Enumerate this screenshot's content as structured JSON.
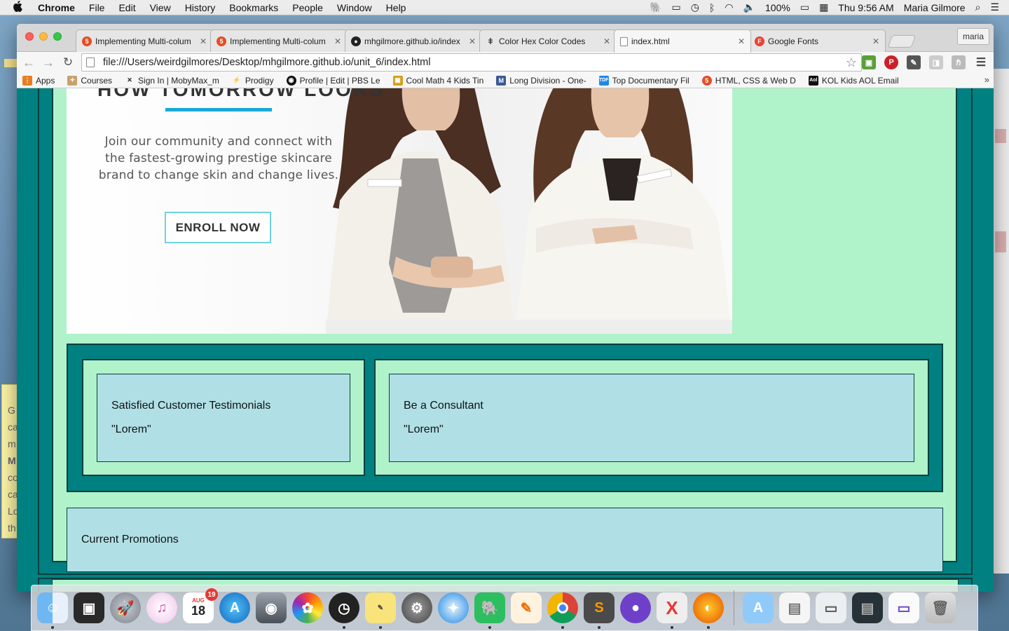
{
  "menubar": {
    "app_name": "Chrome",
    "items": [
      "File",
      "Edit",
      "View",
      "History",
      "Bookmarks",
      "People",
      "Window",
      "Help"
    ],
    "battery": "100%",
    "clock": "Thu 9:56 AM",
    "user": "Maria Gilmore"
  },
  "browser": {
    "tabs": [
      {
        "label": "Implementing Multi-colum",
        "icon": "html-shield-icon",
        "color": "#e44d26"
      },
      {
        "label": "Implementing Multi-colum",
        "icon": "html-shield-icon",
        "color": "#e44d26"
      },
      {
        "label": "mhgilmore.github.io/index",
        "icon": "github-icon",
        "color": "#222222"
      },
      {
        "label": "Color Hex Color Codes",
        "icon": "eyedropper-icon",
        "color": "#333333"
      },
      {
        "label": "index.html",
        "icon": "page-icon",
        "color": "#888888"
      },
      {
        "label": "Google Fonts",
        "icon": "google-fonts-icon",
        "color": "#ea4335"
      }
    ],
    "active_tab": 4,
    "profile": "maria",
    "url": "file:///Users/weirdgilmores/Desktop/mhgilmore.github.io/unit_6/index.html",
    "bookmarks": [
      {
        "label": "Apps",
        "icon": "apps-grid-icon",
        "color": "#e67e22"
      },
      {
        "label": "Courses",
        "icon": "courses-icon",
        "color": "#c9a26b"
      },
      {
        "label": "Sign In | MobyMax_m",
        "icon": "mobymax-icon",
        "color": "#222222"
      },
      {
        "label": "Prodigy",
        "icon": "prodigy-icon",
        "color": "#3f51b5"
      },
      {
        "label": "Profile | Edit | PBS Le",
        "icon": "pbs-icon",
        "color": "#111111"
      },
      {
        "label": "Cool Math 4 Kids Tin",
        "icon": "coolmath-icon",
        "color": "#d4a017"
      },
      {
        "label": "Long Division - One-",
        "icon": "m-icon",
        "color": "#3b5998"
      },
      {
        "label": "Top Documentary Fil",
        "icon": "tdf-icon",
        "color": "#1e88e5"
      },
      {
        "label": "HTML, CSS & Web D",
        "icon": "html-shield-icon",
        "color": "#e44d26"
      },
      {
        "label": "KOL Kids AOL Email",
        "icon": "aol-icon",
        "color": "#111111"
      }
    ]
  },
  "page": {
    "hero": {
      "heading": "HOW TOMORROW LOOKS",
      "subtext": "Join our community and connect with the fastest-growing prestige skincare brand to change skin and change lives.",
      "button": "ENROLL NOW"
    },
    "testimonials": {
      "title": "Satisfied Customer Testimonials",
      "body": "\"Lorem\""
    },
    "consultant": {
      "title": "Be a Consultant",
      "body": "\"Lorem\""
    },
    "promotions": {
      "title": "Current Promotions"
    }
  },
  "dock": {
    "calendar_month": "AUG",
    "calendar_day": "18",
    "calendar_badge": "19",
    "apps": [
      "Finder",
      "Photo Booth",
      "Launchpad",
      "iTunes",
      "Calendar",
      "App Store",
      "Image Capture",
      "Photos",
      "Dashboard",
      "Stickies",
      "System Preferences",
      "Safari",
      "Evernote",
      "Pages",
      "Chrome",
      "Sublime Text",
      "GitHub Desktop",
      "X11",
      "Firefox"
    ]
  },
  "desktop": {
    "sticky_lines": [
      "G",
      "ca",
      "m",
      "M",
      "co",
      "ca",
      "Lo",
      "th"
    ]
  },
  "colors": {
    "teal": "#008080",
    "mint": "#b0f2ca",
    "powder_blue": "#b0e0e6",
    "accent_blue": "#1aa9d6"
  }
}
